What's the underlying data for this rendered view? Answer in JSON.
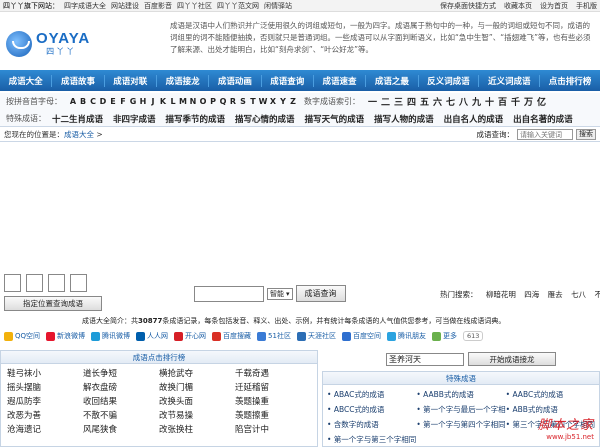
{
  "topbar": {
    "left": [
      "四丫丫旗下网站：",
      "四字成语大全",
      "网站建设",
      "百度影音",
      "四丫丫社区",
      "四丫丫范文网",
      "闲情驿站"
    ],
    "right": [
      "保存桌面快捷方式",
      "收藏本页",
      "设为首页",
      "手机版"
    ]
  },
  "logo": {
    "text": "OYAYA",
    "sub": "四丫丫"
  },
  "intro": "成语是汉语中人们熟识并广泛使用很久的词组或短句，一般为四字。成语属于熟句中的一种，与一般的词组或短句不同，成语的词组里的词不能随便抽换，否则就只是普通词组。一些成语可以从字面判断语义，比如“急中生智”、“插翅难飞”等，也有些必须了解来源、出处才能明白，比如“刻舟求剑”、“叶公好龙”等。",
  "nav": [
    "成语大全",
    "成语故事",
    "成语对联",
    "成语接龙",
    "成语动画",
    "成语查询",
    "成语速查",
    "成语之最",
    "反义词成语",
    "近义词成语",
    "点击排行榜"
  ],
  "index": {
    "pinyin_label": "按拼音首字母：",
    "letters": [
      "A",
      "B",
      "C",
      "D",
      "E",
      "F",
      "G",
      "H",
      "J",
      "K",
      "L",
      "M",
      "N",
      "O",
      "P",
      "Q",
      "R",
      "S",
      "T",
      "W",
      "X",
      "Y",
      "Z"
    ],
    "number_label": "数字成语索引：",
    "numbers": [
      "一",
      "二",
      "三",
      "四",
      "五",
      "六",
      "七",
      "八",
      "九",
      "十",
      "百",
      "千",
      "万",
      "亿"
    ],
    "special_label": "特殊成语：",
    "specials": [
      "十二生肖成语",
      "非四字成语",
      "描写季节的成语",
      "描写心情的成语",
      "描写天气的成语",
      "描写人物的成语",
      "出自名人的成语",
      "出自名著的成语"
    ]
  },
  "crumb": {
    "prefix": "您现在的位置是：",
    "link": "成语大全",
    "sep": ">"
  },
  "search": {
    "label": "成语查询：",
    "placeholder": "请输入关键词",
    "button": "搜索"
  },
  "position": {
    "button": "指定位置查询成语"
  },
  "smart": {
    "select": "智能",
    "button": "成语查询"
  },
  "hot": {
    "label": "热门搜索：",
    "items": [
      "柳暗花明",
      "四海",
      "雁去",
      "七八",
      "不惜"
    ]
  },
  "summary": {
    "prefix": "成语大全简介：共",
    "count": "30877",
    "rest": "条成语记录，每条包括发音、释义、出处、示例，并有统计每条成语的人气值供您参考，可当做在线成语词典。"
  },
  "share": {
    "items": [
      {
        "label": "QQ空间",
        "color": "#f2b10c"
      },
      {
        "label": "新浪微博",
        "color": "#e6162d"
      },
      {
        "label": "腾讯微博",
        "color": "#1d9bd8"
      },
      {
        "label": "人人网",
        "color": "#005eac"
      },
      {
        "label": "开心网",
        "color": "#d61f26"
      },
      {
        "label": "百度搜藏",
        "color": "#d93025"
      },
      {
        "label": "51社区",
        "color": "#3a7bd5"
      },
      {
        "label": "天涯社区",
        "color": "#2c6eb5"
      },
      {
        "label": "百度空间",
        "color": "#2f6fcf"
      },
      {
        "label": "腾讯朋友",
        "color": "#2ba3e0"
      },
      {
        "label": "更多",
        "color": "#6ab04c"
      }
    ],
    "count": "613"
  },
  "rank": {
    "title": "成语点击排行榜",
    "words": [
      "鞋弓袜小",
      "道长争短",
      "横抢武夺",
      "千载奇遇",
      "摇头摆脑",
      "解衣盘磅",
      "故换门楣",
      "迁延稽留",
      "遐瓜防李",
      "收回结果",
      "改换头面",
      "羡题操重",
      "改恶为善",
      "不散不骗",
      "改节易操",
      "羡题擦重",
      "沧海遗记",
      "风尾狭食",
      "改张换柱",
      "陷宫计中"
    ]
  },
  "dragon": {
    "input": "圣养河天",
    "button": "开始成语接龙"
  },
  "special_box": {
    "title": "特殊成语",
    "items": [
      "ABAC式的成语",
      "AABB式的成语",
      "AABC式的成语",
      "ABCC式的成语",
      "第一个字与最后一个字相同",
      "ABB式的成语",
      "含数字的成语",
      "第一个字与第四个字相同",
      "第三个字与第四个字相同的成语",
      "第一个字与第三个字相同"
    ]
  },
  "watermark": {
    "cn": "脚本之家",
    "url": "www.jb51.net"
  }
}
